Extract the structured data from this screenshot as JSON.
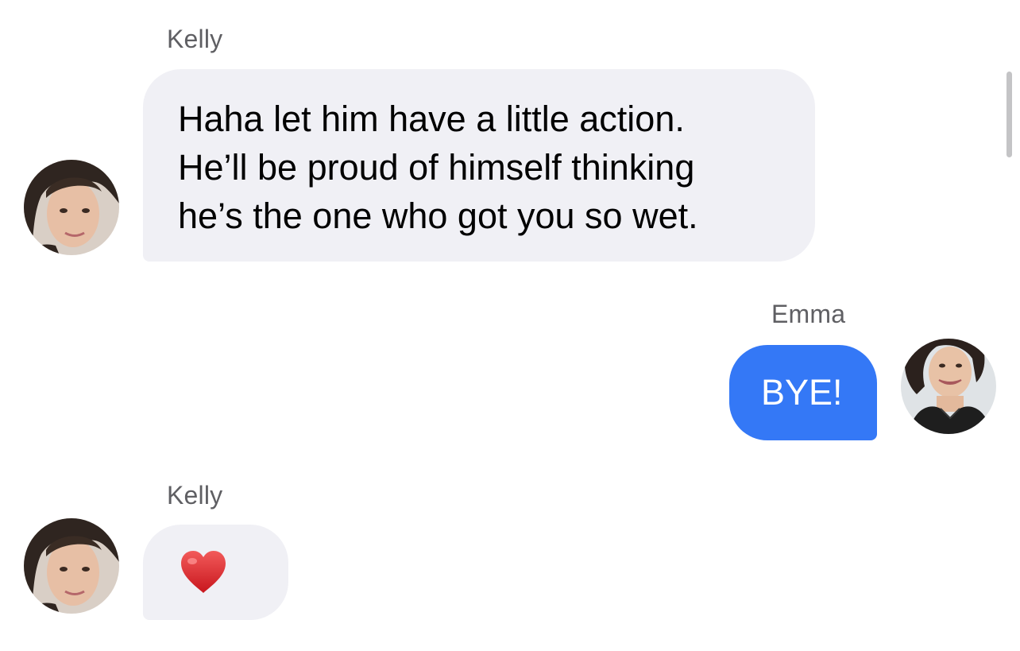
{
  "messages": [
    {
      "sender": "Kelly",
      "direction": "received",
      "lines": [
        "Haha let him have a little action.",
        "He’ll be proud of himself thinking",
        "he’s the one who got you so wet."
      ]
    },
    {
      "sender": "Emma",
      "direction": "sent",
      "text": "BYE!"
    },
    {
      "sender": "Kelly",
      "direction": "received",
      "text": "❤️"
    }
  ],
  "colors": {
    "received_bubble": "#f0f0f5",
    "sent_bubble": "#3478f6",
    "sender_name": "#5f5f63"
  }
}
